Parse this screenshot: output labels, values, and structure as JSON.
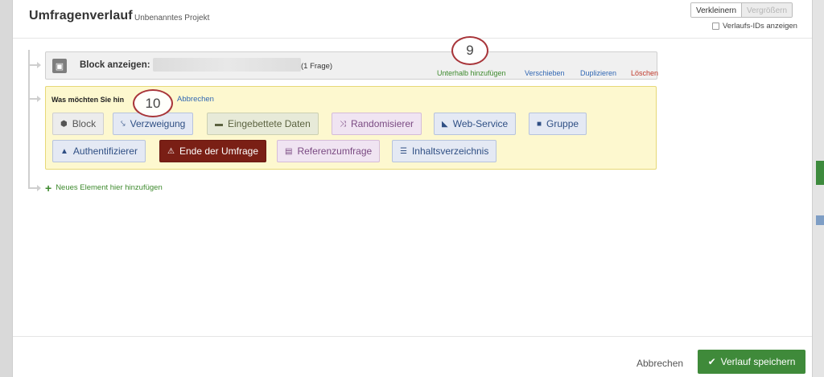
{
  "header": {
    "title": "Umfragenverlauf",
    "project": "Unbenanntes Projekt",
    "zoom_out": "Verkleinern",
    "zoom_in": "Vergrößern",
    "show_ids": "Verlaufs-IDs anzeigen"
  },
  "block": {
    "label": "Block anzeigen:",
    "count": "(1 Frage)",
    "actions": {
      "add_below": "Unterhalb hinzufügen",
      "move": "Verschieben",
      "duplicate": "Duplizieren",
      "delete": "Löschen"
    }
  },
  "ask": {
    "prompt": "Was möchten Sie hin",
    "cancel": "Abbrechen",
    "options": [
      {
        "label": "Block",
        "icon": "cube-icon"
      },
      {
        "label": "Verzweigung",
        "icon": "branch-icon"
      },
      {
        "label": "Eingebettete Daten",
        "icon": "data-icon"
      },
      {
        "label": "Randomisierer",
        "icon": "shuffle-icon"
      },
      {
        "label": "Web-Service",
        "icon": "rss-icon"
      },
      {
        "label": "Gruppe",
        "icon": "folder-icon"
      },
      {
        "label": "Authentifizierer",
        "icon": "lock-icon"
      },
      {
        "label": "Ende der Umfrage",
        "icon": "warning-icon"
      },
      {
        "label": "Referenzumfrage",
        "icon": "clipboard-icon"
      },
      {
        "label": "Inhaltsverzeichnis",
        "icon": "list-icon"
      }
    ]
  },
  "annotations": {
    "circle_9": "9",
    "circle_10": "10"
  },
  "add_new": "Neues Element hier hinzufügen",
  "footer": {
    "cancel": "Abbrechen",
    "save": "Verlauf speichern"
  },
  "colors": {
    "save_green": "#3f8a3a",
    "end_survey_dark_red": "#7a1f15",
    "link_blue": "#3167b3",
    "delete_red": "#c0392b",
    "annotation_ring": "#a8353a"
  }
}
